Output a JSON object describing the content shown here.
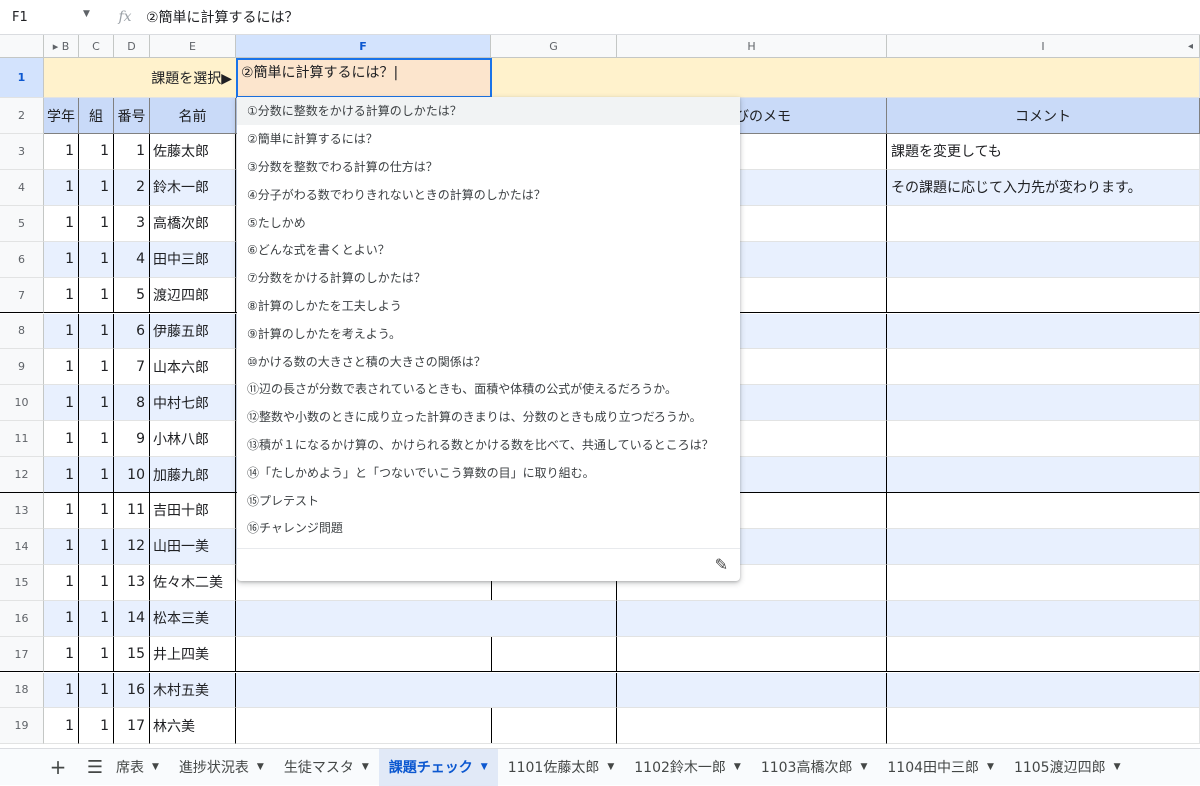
{
  "formula_bar": {
    "cell_ref": "F1",
    "fx": "fx",
    "value": "②簡単に計算するには？"
  },
  "columns": [
    "B",
    "C",
    "D",
    "E",
    "F",
    "G",
    "H",
    "I"
  ],
  "row1": {
    "label": "課題を選択▶",
    "value": "②簡単に計算するには？|"
  },
  "headers": {
    "grade": "学年",
    "class": "組",
    "number": "番号",
    "name": "名前",
    "memo": "びのメモ",
    "comment": "コメント"
  },
  "rows": [
    {
      "r": "3",
      "g": "1",
      "c": "1",
      "n": "1",
      "name": "佐藤太郎",
      "comment": "課題を変更しても"
    },
    {
      "r": "4",
      "g": "1",
      "c": "1",
      "n": "2",
      "name": "鈴木一郎",
      "comment": "その課題に応じて入力先が変わります。"
    },
    {
      "r": "5",
      "g": "1",
      "c": "1",
      "n": "3",
      "name": "高橋次郎",
      "comment": ""
    },
    {
      "r": "6",
      "g": "1",
      "c": "1",
      "n": "4",
      "name": "田中三郎",
      "comment": ""
    },
    {
      "r": "7",
      "g": "1",
      "c": "1",
      "n": "5",
      "name": "渡辺四郎",
      "comment": ""
    },
    {
      "r": "8",
      "g": "1",
      "c": "1",
      "n": "6",
      "name": "伊藤五郎",
      "comment": ""
    },
    {
      "r": "9",
      "g": "1",
      "c": "1",
      "n": "7",
      "name": "山本六郎",
      "comment": ""
    },
    {
      "r": "10",
      "g": "1",
      "c": "1",
      "n": "8",
      "name": "中村七郎",
      "comment": ""
    },
    {
      "r": "11",
      "g": "1",
      "c": "1",
      "n": "9",
      "name": "小林八郎",
      "comment": ""
    },
    {
      "r": "12",
      "g": "1",
      "c": "1",
      "n": "10",
      "name": "加藤九郎",
      "comment": ""
    },
    {
      "r": "13",
      "g": "1",
      "c": "1",
      "n": "11",
      "name": "吉田十郎",
      "comment": ""
    },
    {
      "r": "14",
      "g": "1",
      "c": "1",
      "n": "12",
      "name": "山田一美",
      "comment": ""
    },
    {
      "r": "15",
      "g": "1",
      "c": "1",
      "n": "13",
      "name": "佐々木二美",
      "comment": ""
    },
    {
      "r": "16",
      "g": "1",
      "c": "1",
      "n": "14",
      "name": "松本三美",
      "comment": ""
    },
    {
      "r": "17",
      "g": "1",
      "c": "1",
      "n": "15",
      "name": "井上四美",
      "comment": ""
    },
    {
      "r": "18",
      "g": "1",
      "c": "1",
      "n": "16",
      "name": "木村五美",
      "comment": ""
    },
    {
      "r": "19",
      "g": "1",
      "c": "1",
      "n": "17",
      "name": "林六美",
      "comment": ""
    }
  ],
  "dropdown": {
    "options": [
      "①分数に整数をかける計算のしかたは？",
      "②簡単に計算するには？",
      "③分数を整数でわる計算の仕方は？",
      "④分子がわる数でわりきれないときの計算のしかたは？",
      "⑤たしかめ",
      "⑥どんな式を書くとよい？",
      "⑦分数をかける計算のしかたは？",
      "⑧計算のしかたを工夫しよう",
      "⑨計算のしかたを考えよう。",
      "⑩かける数の大きさと積の大きさの関係は？",
      "⑪辺の長さが分数で表されているときも、面積や体積の公式が使えるだろうか。",
      "⑫整数や小数のときに成り立った計算のきまりは、分数のときも成り立つだろうか。",
      "⑬積が１になるかけ算の、かけられる数とかける数を比べて、共通しているところは？",
      "⑭「たしかめよう」と「つないでいこう算数の目」に取り組む。",
      "⑮プレテスト",
      "⑯チャレンジ問題"
    ],
    "edit_icon": "pencil-icon"
  },
  "tabs": [
    {
      "label": "席表",
      "active": false
    },
    {
      "label": "進捗状況表",
      "active": false
    },
    {
      "label": "生徒マスタ",
      "active": false
    },
    {
      "label": "課題チェック",
      "active": true
    },
    {
      "label": "1101佐藤太郎",
      "active": false
    },
    {
      "label": "1102鈴木一郎",
      "active": false
    },
    {
      "label": "1103高橋次郎",
      "active": false
    },
    {
      "label": "1104田中三郎",
      "active": false
    },
    {
      "label": "1105渡辺四郎",
      "active": false
    }
  ],
  "colors": {
    "header_blue": "#c9daf8",
    "alt_row": "#e8f0fe",
    "yellow": "#fff2cc",
    "selected_cell": "#fce5cd",
    "accent": "#1a73e8"
  }
}
